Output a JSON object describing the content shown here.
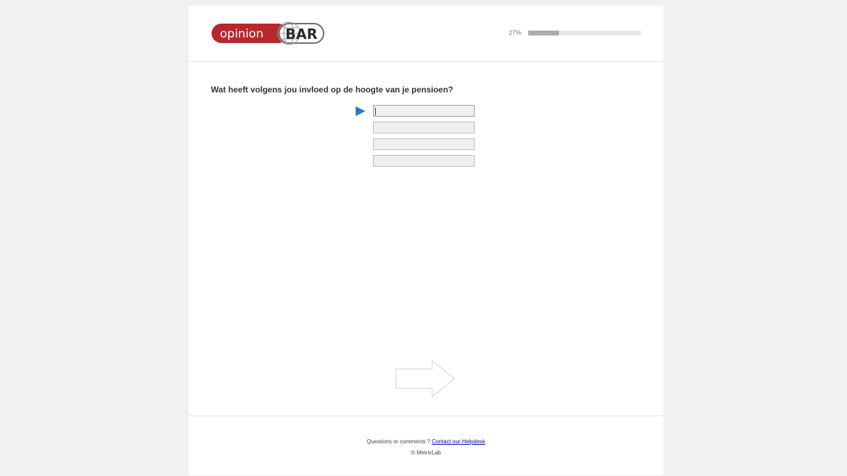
{
  "header": {
    "logo": {
      "word1": "opinion",
      "word2": "BAR"
    },
    "progress": {
      "label": "27%",
      "value": 0.27
    }
  },
  "question": {
    "text": "Wat heeft volgens jou invloed op de hoogte van je pensioen?",
    "answers": [
      {
        "value": ""
      },
      {
        "value": ""
      },
      {
        "value": ""
      },
      {
        "value": ""
      }
    ]
  },
  "navigation": {
    "next_icon": "right-arrow-icon"
  },
  "footer": {
    "prefix": "Questions or comments ? ",
    "link_text": "Contact our Helpdesk",
    "copyright": "© MetrixLab"
  },
  "colors": {
    "logo_red": "#b7282e",
    "indicator_blue": "#1e7ccd",
    "progress_fill": "#ababab",
    "progress_track": "#e6e6e6"
  }
}
